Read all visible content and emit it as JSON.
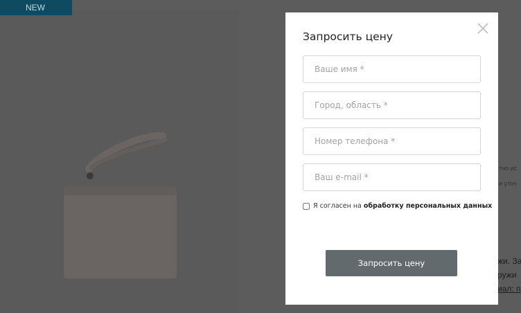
{
  "background": {
    "badge": "NEW",
    "side_text": {
      "line1": "тно ис",
      "line2": "и уточ",
      "line3": "жи. За",
      "line4": "ружи",
      "line5": "иал: п"
    }
  },
  "modal": {
    "title": "Запросить цену",
    "fields": {
      "name_placeholder": "Ваше имя *",
      "city_placeholder": "Город, область *",
      "phone_placeholder": "Номер телефона *",
      "email_placeholder": "Ваш e-mail *"
    },
    "consent": {
      "prefix": "Я согласен на",
      "link": "обработку персональных данных"
    },
    "submit_label": "Запросить цену"
  },
  "colors": {
    "overlay": "#5c5c5c",
    "badge_bg": "#0e4b60",
    "button_bg": "#626a6d",
    "modal_bg": "#ffffff"
  }
}
